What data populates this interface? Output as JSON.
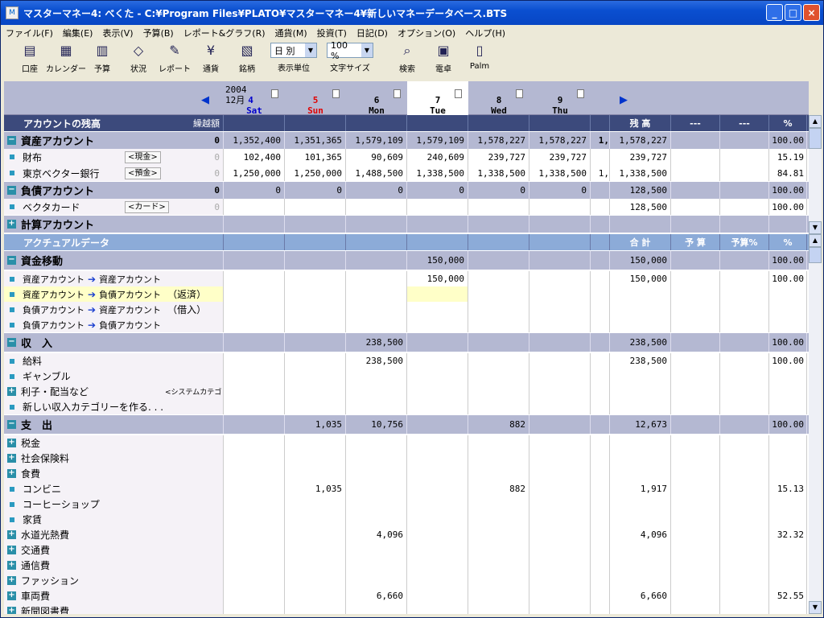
{
  "window": {
    "title": "マスターマネー4: べくた - C:¥Program Files¥PLATO¥マスターマネー4¥新しいマネーデータベース.BTS"
  },
  "menu": [
    "ファイル(F)",
    "編集(E)",
    "表示(V)",
    "予算(B)",
    "レポート&グラフ(R)",
    "通貨(M)",
    "投資(T)",
    "日記(D)",
    "オプション(O)",
    "ヘルプ(H)"
  ],
  "toolbar": {
    "tools": [
      {
        "label": "口座",
        "icon": "account-icon"
      },
      {
        "label": "カレンダー",
        "icon": "calendar-icon"
      },
      {
        "label": "予算",
        "icon": "budget-icon"
      },
      {
        "label": "状況",
        "icon": "status-icon"
      },
      {
        "label": "レポート",
        "icon": "report-icon"
      },
      {
        "label": "通貨",
        "icon": "currency-icon"
      },
      {
        "label": "銘柄",
        "icon": "stock-icon"
      }
    ],
    "display_unit": {
      "value": "日 別",
      "label": "表示単位"
    },
    "font_size": {
      "value": "100 %",
      "label": "文字サイズ"
    },
    "tools2": [
      {
        "label": "検索",
        "icon": "search-icon"
      },
      {
        "label": "電卓",
        "icon": "calculator-icon"
      },
      {
        "label": "Palm",
        "icon": "palm-icon"
      }
    ]
  },
  "header": {
    "year": "2004",
    "month": "12月",
    "days": [
      {
        "num": "4",
        "dow": "Sat"
      },
      {
        "num": "5",
        "dow": "Sun"
      },
      {
        "num": "6",
        "dow": "Mon"
      },
      {
        "num": "7",
        "dow": "Tue"
      },
      {
        "num": "8",
        "dow": "Wed"
      },
      {
        "num": "9",
        "dow": "Thu"
      }
    ]
  },
  "balance": {
    "title": "アカウントの残高",
    "carry": "繰越額",
    "col_headers": [
      "残 高",
      "---",
      "---",
      "%"
    ],
    "sections": [
      {
        "name": "資産アカウント",
        "carry": "0",
        "vals": [
          "1,352,400",
          "1,351,365",
          "1,579,109",
          "1,579,109",
          "1,578,227",
          "1,578,227"
        ],
        "extra": "1,",
        "sum": "1,578,227",
        "pct": "100.00",
        "items": [
          {
            "name": "財布",
            "tag": "<現金>",
            "carry": "0",
            "vals": [
              "102,400",
              "101,365",
              "90,609",
              "240,609",
              "239,727",
              "239,727"
            ],
            "extra": "",
            "sum": "239,727",
            "pct": "15.19"
          },
          {
            "name": "東京ベクター銀行",
            "tag": "<預金>",
            "carry": "0",
            "vals": [
              "1,250,000",
              "1,250,000",
              "1,488,500",
              "1,338,500",
              "1,338,500",
              "1,338,500"
            ],
            "extra": "1,",
            "sum": "1,338,500",
            "pct": "84.81"
          }
        ]
      },
      {
        "name": "負債アカウント",
        "carry": "0",
        "vals": [
          "0",
          "0",
          "0",
          "0",
          "0",
          "0"
        ],
        "extra": "",
        "sum": "128,500",
        "pct": "100.00",
        "items": [
          {
            "name": "ベクタカード",
            "tag": "<カード>",
            "carry": "0",
            "vals": [
              "",
              "",
              "",
              "",
              "",
              ""
            ],
            "extra": "",
            "sum": "128,500",
            "pct": "100.00"
          }
        ]
      },
      {
        "name": "計算アカウント",
        "carry": "",
        "vals": [
          "",
          "",
          "",
          "",
          "",
          ""
        ],
        "extra": "",
        "sum": "",
        "pct": "",
        "items": []
      }
    ]
  },
  "actual": {
    "title": "アクチュアルデータ",
    "col_headers": [
      "合 計",
      "予 算",
      "予算%",
      "%"
    ],
    "transfer": {
      "name": "資金移動",
      "vals": [
        "",
        "",
        "",
        "150,000",
        "",
        ""
      ],
      "sum": "150,000",
      "pct": "100.00",
      "items": [
        {
          "from": "資産アカウント",
          "to": "資産アカウント",
          "note": "",
          "vals": [
            "",
            "",
            "",
            "150,000",
            "",
            ""
          ],
          "sum": "150,000",
          "pct": "100.00"
        },
        {
          "from": "資産アカウント",
          "to": "負債アカウント",
          "note": "（返済）",
          "vals": [
            "",
            "",
            "",
            "",
            "",
            ""
          ],
          "sum": "",
          "pct": ""
        },
        {
          "from": "負債アカウント",
          "to": "資産アカウント",
          "note": "（借入）",
          "vals": [
            "",
            "",
            "",
            "",
            "",
            ""
          ],
          "sum": "",
          "pct": ""
        },
        {
          "from": "負債アカウント",
          "to": "負債アカウント",
          "note": "",
          "vals": [
            "",
            "",
            "",
            "",
            "",
            ""
          ],
          "sum": "",
          "pct": ""
        }
      ]
    },
    "income": {
      "name": "収　入",
      "vals": [
        "",
        "",
        "238,500",
        "",
        "",
        ""
      ],
      "sum": "238,500",
      "pct": "100.00",
      "items": [
        {
          "name": "給料",
          "expand": false,
          "tag": "",
          "vals": [
            "",
            "",
            "238,500",
            "",
            "",
            ""
          ],
          "sum": "238,500",
          "pct": "100.00"
        },
        {
          "name": "ギャンブル",
          "expand": false,
          "tag": "",
          "vals": [
            "",
            "",
            "",
            "",
            "",
            ""
          ],
          "sum": "",
          "pct": ""
        },
        {
          "name": "利子・配当など",
          "expand": true,
          "tag": "<システムカテゴリー>",
          "vals": [
            "",
            "",
            "",
            "",
            "",
            ""
          ],
          "sum": "",
          "pct": ""
        },
        {
          "name": "新しい収入カテゴリーを作る. . .",
          "expand": false,
          "tag": "",
          "vals": [
            "",
            "",
            "",
            "",
            "",
            ""
          ],
          "sum": "",
          "pct": ""
        }
      ]
    },
    "expense": {
      "name": "支　出",
      "vals": [
        "",
        "1,035",
        "10,756",
        "",
        "882",
        ""
      ],
      "sum": "12,673",
      "pct": "100.00",
      "items": [
        {
          "name": "税金",
          "expand": true,
          "vals": [
            "",
            "",
            "",
            "",
            "",
            ""
          ],
          "sum": "",
          "pct": ""
        },
        {
          "name": "社会保険料",
          "expand": true,
          "vals": [
            "",
            "",
            "",
            "",
            "",
            ""
          ],
          "sum": "",
          "pct": ""
        },
        {
          "name": "食費",
          "expand": true,
          "vals": [
            "",
            "",
            "",
            "",
            "",
            ""
          ],
          "sum": "",
          "pct": ""
        },
        {
          "name": "コンビニ",
          "expand": false,
          "vals": [
            "",
            "1,035",
            "",
            "",
            "882",
            ""
          ],
          "sum": "1,917",
          "pct": "15.13"
        },
        {
          "name": "コーヒーショップ",
          "expand": false,
          "vals": [
            "",
            "",
            "",
            "",
            "",
            ""
          ],
          "sum": "",
          "pct": ""
        },
        {
          "name": "家賃",
          "expand": false,
          "vals": [
            "",
            "",
            "",
            "",
            "",
            ""
          ],
          "sum": "",
          "pct": ""
        },
        {
          "name": "水道光熱費",
          "expand": true,
          "vals": [
            "",
            "",
            "4,096",
            "",
            "",
            ""
          ],
          "sum": "4,096",
          "pct": "32.32"
        },
        {
          "name": "交通費",
          "expand": true,
          "vals": [
            "",
            "",
            "",
            "",
            "",
            ""
          ],
          "sum": "",
          "pct": ""
        },
        {
          "name": "通信費",
          "expand": true,
          "vals": [
            "",
            "",
            "",
            "",
            "",
            ""
          ],
          "sum": "",
          "pct": ""
        },
        {
          "name": "ファッション",
          "expand": true,
          "vals": [
            "",
            "",
            "",
            "",
            "",
            ""
          ],
          "sum": "",
          "pct": ""
        },
        {
          "name": "車両費",
          "expand": true,
          "vals": [
            "",
            "",
            "6,660",
            "",
            "",
            ""
          ],
          "sum": "6,660",
          "pct": "52.55"
        },
        {
          "name": "新聞図書費",
          "expand": true,
          "vals": [
            "",
            "",
            "",
            "",
            "",
            ""
          ],
          "sum": "",
          "pct": ""
        }
      ]
    }
  },
  "colors": {
    "title_bar": "#0a4fd0",
    "section_header": "#3c4a7c",
    "section_row": "#b4b8d2",
    "actual_header": "#8cabd8",
    "sun": "#e00000",
    "sat": "#0000cc",
    "highlight": "#ffffc8"
  }
}
